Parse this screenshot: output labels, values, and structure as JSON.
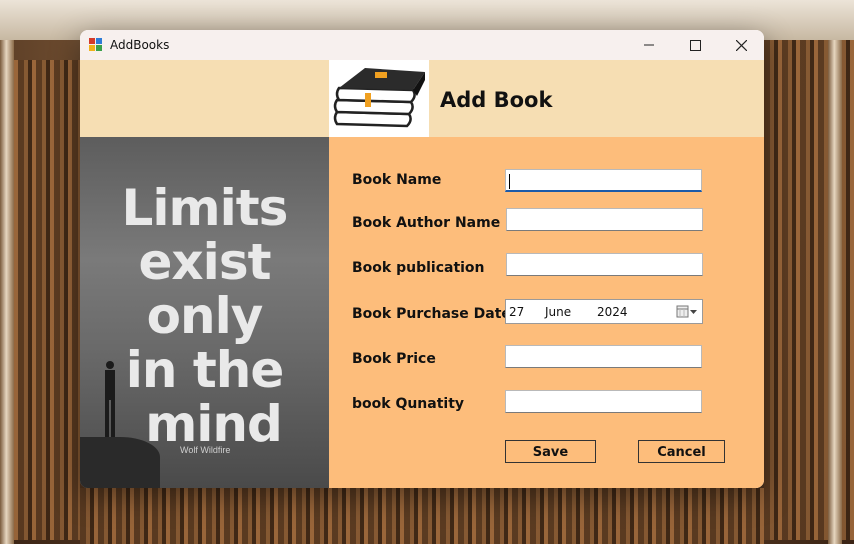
{
  "window": {
    "title": "AddBooks",
    "controls": {
      "minimize": "—",
      "maximize": "☐",
      "close": "✕"
    }
  },
  "header": {
    "title": "Add Book",
    "icon": "books-stack-icon"
  },
  "poster": {
    "lines": [
      "Limits",
      "exist",
      "only",
      "in the",
      "mind"
    ],
    "author": "Wolf Wildfire"
  },
  "form": {
    "book_name": {
      "label": "Book Name",
      "value": ""
    },
    "author_name": {
      "label": "Book Author Name",
      "value": ""
    },
    "publication": {
      "label": "Book publication",
      "value": ""
    },
    "purchase_date": {
      "label": "Book Purchase Date",
      "day": "27",
      "month": "June",
      "year": "2024"
    },
    "price": {
      "label": "Book Price",
      "value": ""
    },
    "quantity": {
      "label": "book Qunatity",
      "value": ""
    }
  },
  "buttons": {
    "save": "Save",
    "cancel": "Cancel"
  },
  "colors": {
    "header_band": "#f6deb3",
    "form_bg": "#fdbd7b",
    "titlebar": "#f7f0ee"
  }
}
